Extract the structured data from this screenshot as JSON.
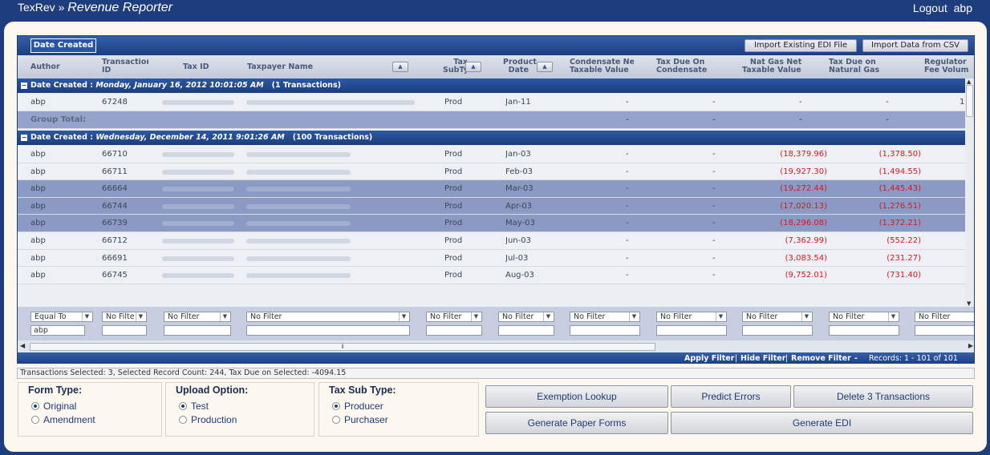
{
  "app": {
    "name": "TexRev",
    "separator": "»",
    "page_title": "Revenue Reporter",
    "logout_label": "Logout",
    "username": "abp"
  },
  "toolbar": {
    "date_created_button": "Date Created",
    "import_edi_button": "Import Existing EDI File",
    "import_csv_button": "Import Data from CSV"
  },
  "columns": {
    "author": "Author",
    "transaction_id": "Transaction\nID",
    "tax_id": "Tax ID",
    "taxpayer_name": "Taxpayer Name",
    "tax_subtype": "    Tax\nSubTyp",
    "production_date": "Product\n  Date",
    "condensate_net": "Condensate Net\nTaxable Value",
    "tax_due_condensate": "Tax Due On\nCondensate",
    "nat_gas_net": "   Nat Gas Net\nTaxable Value",
    "tax_due_nat_gas": "Tax Due on\nNatural Gas",
    "regulatory_fee": "Regulator\nFee Volum"
  },
  "groups": [
    {
      "label": "Date Created : ",
      "date": "Monday, January 16, 2012 10:01:05 AM",
      "count": "(1 Transactions)"
    },
    {
      "label": "Date Created : ",
      "date": "Wednesday, December 14, 2011 9:01:26 AM",
      "count": "(100 Transactions)"
    }
  ],
  "group_total_label": "Group Total:",
  "rows": [
    {
      "author": "abp",
      "id": "67248",
      "subtype": "Prod",
      "date": "Jan-11",
      "cond_net": "-",
      "cond_tax": "-",
      "gas_net": "-",
      "gas_tax": "-",
      "fee": "1"
    },
    {
      "author": "abp",
      "id": "66710",
      "subtype": "Prod",
      "date": "Jan-03",
      "cond_net": "-",
      "cond_tax": "-",
      "gas_net": "(18,379.96)",
      "gas_tax": "(1,378.50)",
      "fee": ""
    },
    {
      "author": "abp",
      "id": "66711",
      "subtype": "Prod",
      "date": "Feb-03",
      "cond_net": "-",
      "cond_tax": "-",
      "gas_net": "(19,927.30)",
      "gas_tax": "(1,494.55)",
      "fee": ""
    },
    {
      "author": "abp",
      "id": "66664",
      "subtype": "Prod",
      "date": "Mar-03",
      "cond_net": "-",
      "cond_tax": "-",
      "gas_net": "(19,272.44)",
      "gas_tax": "(1,445.43)",
      "fee": ""
    },
    {
      "author": "abp",
      "id": "66744",
      "subtype": "Prod",
      "date": "Apr-03",
      "cond_net": "-",
      "cond_tax": "-",
      "gas_net": "(17,020.13)",
      "gas_tax": "(1,276.51)",
      "fee": ""
    },
    {
      "author": "abp",
      "id": "66739",
      "subtype": "Prod",
      "date": "May-03",
      "cond_net": "-",
      "cond_tax": "-",
      "gas_net": "(18,296.08)",
      "gas_tax": "(1,372.21)",
      "fee": ""
    },
    {
      "author": "abp",
      "id": "66712",
      "subtype": "Prod",
      "date": "Jun-03",
      "cond_net": "-",
      "cond_tax": "-",
      "gas_net": "(7,362.99)",
      "gas_tax": "(552.22)",
      "fee": ""
    },
    {
      "author": "abp",
      "id": "66691",
      "subtype": "Prod",
      "date": "Jul-03",
      "cond_net": "-",
      "cond_tax": "-",
      "gas_net": "(3,083.54)",
      "gas_tax": "(231.27)",
      "fee": ""
    },
    {
      "author": "abp",
      "id": "66745",
      "subtype": "Prod",
      "date": "Aug-03",
      "cond_net": "-",
      "cond_tax": "-",
      "gas_net": "(9,752.01)",
      "gas_tax": "(731.40)",
      "fee": ""
    }
  ],
  "group_total": {
    "cond_net": "-",
    "cond_tax": "-",
    "gas_net": "-",
    "gas_tax": "-"
  },
  "filters": {
    "author_op": "Equal To",
    "author_value": "abp",
    "no_filter": "No Filter",
    "no_filter_short": "No Filte"
  },
  "footer": {
    "apply_filter": "Apply Filter",
    "hide_filter": "Hide Filter",
    "remove_filter": "Remove Filter",
    "separator": "|",
    "dash": "-",
    "records": "Records: 1 - 101 of 101"
  },
  "status_text": "Transactions Selected: 3, Selected Record Count: 244, Tax Due on Selected: -4094.15",
  "form_type": {
    "title": "Form Type:",
    "options": [
      "Original",
      "Amendment"
    ],
    "selected": "Original"
  },
  "upload_option": {
    "title": "Upload Option:",
    "options": [
      "Test",
      "Production"
    ],
    "selected": "Test"
  },
  "tax_sub_type": {
    "title": "Tax Sub Type:",
    "options": [
      "Producer",
      "Purchaser"
    ],
    "selected": "Producer"
  },
  "actions": {
    "exemption_lookup": "Exemption Lookup",
    "predict_errors": "Predict Errors",
    "delete": "Delete 3 Transactions",
    "generate_paper": "Generate Paper Forms",
    "generate_edi": "Generate EDI"
  },
  "colors": {
    "brand": "#1e3d7c",
    "negative": "#d8161c",
    "selected_row": "#8a9ac4"
  }
}
